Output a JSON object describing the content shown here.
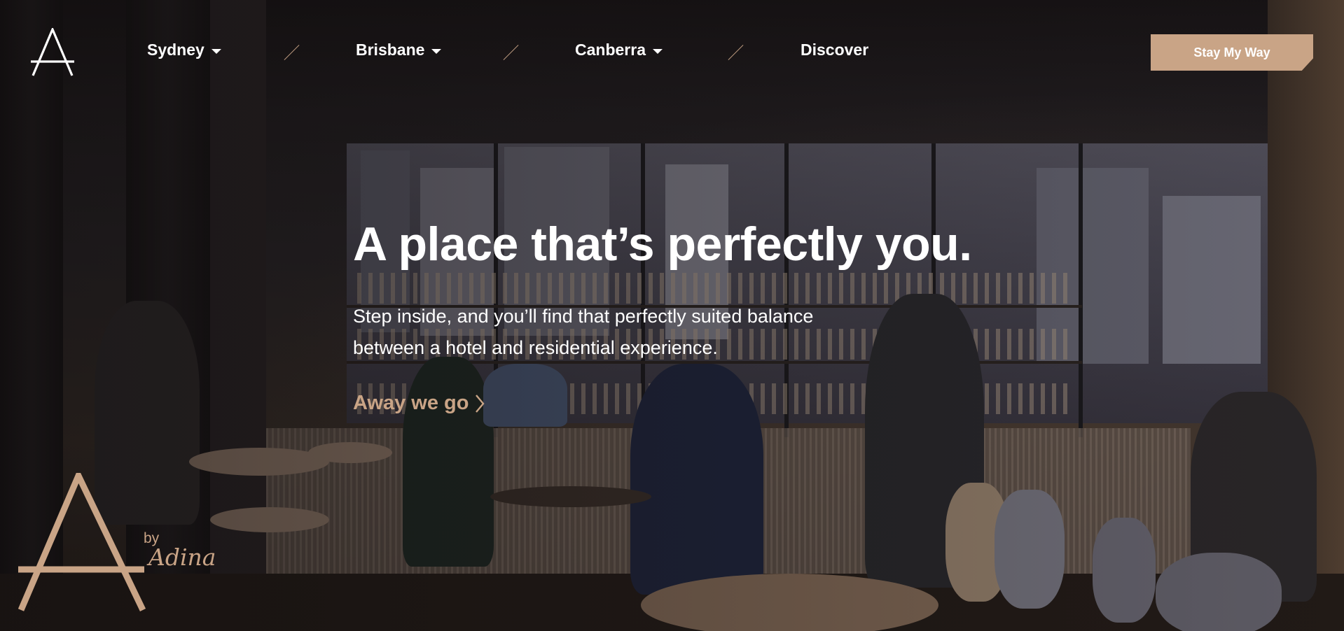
{
  "nav": {
    "items": [
      {
        "label": "Sydney",
        "has_dropdown": true
      },
      {
        "label": "Brisbane",
        "has_dropdown": true
      },
      {
        "label": "Canberra",
        "has_dropdown": true
      },
      {
        "label": "Discover",
        "has_dropdown": false
      }
    ],
    "cta_label": "Stay My Way"
  },
  "hero": {
    "headline": "A place that’s perfectly you.",
    "subcopy": "Step inside, and you’ll find that perfectly suited balance between a hotel and residential experience.",
    "link_label": "Away we go"
  },
  "brand": {
    "by": "by",
    "name": "Adina"
  },
  "colors": {
    "accent": "#c9a486",
    "text": "#ffffff"
  },
  "icons": {
    "logo": "a-monogram-logo",
    "dropdown": "chevron-down-icon",
    "link_arrow": "chevron-right-icon"
  }
}
